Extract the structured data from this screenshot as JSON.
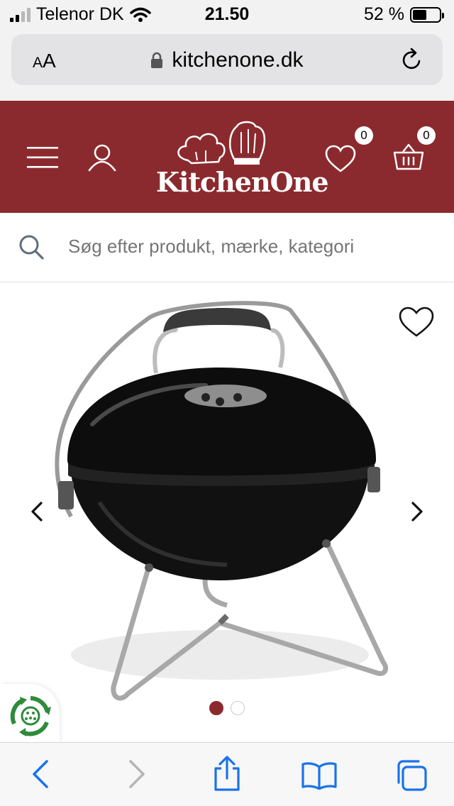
{
  "status_bar": {
    "carrier": "Telenor DK",
    "time": "21.50",
    "battery_percent": "52 %",
    "battery_level": 0.52
  },
  "browser": {
    "aa_large": "A",
    "aa_small": "A",
    "url": "kitchenone.dk"
  },
  "header": {
    "logo_text": "KitchenOne",
    "wishlist_count": "0",
    "cart_count": "0",
    "brand_color": "#8b2a2e"
  },
  "search": {
    "placeholder": "Søg efter produkt, mærke, kategori"
  },
  "gallery": {
    "total_images": 2,
    "active_index": 0
  },
  "icons": [
    "wifi-icon",
    "lock-icon",
    "reload-icon",
    "menu-icon",
    "user-icon",
    "heart-icon",
    "basket-icon",
    "search-icon",
    "chevron-left-icon",
    "chevron-right-icon",
    "recycle-icon",
    "back-icon",
    "forward-icon",
    "share-icon",
    "bookmarks-icon",
    "tabs-icon"
  ]
}
